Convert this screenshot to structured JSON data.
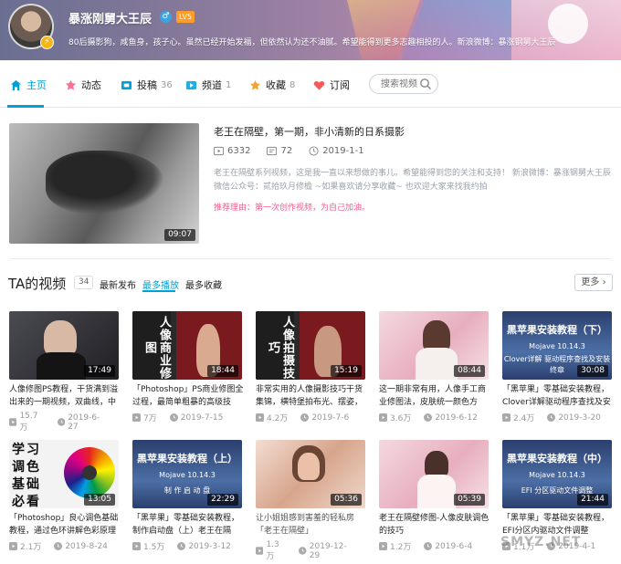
{
  "profile": {
    "name": "暴涨刚舅大王辰",
    "level": "LV5",
    "gender_symbol": "♂",
    "verified_symbol": "⚡",
    "signature": "80后摄影狗，咸鱼身，孩子心。虽然已经开始发福，但依然认为还不油腻。希望能得到更多志趣相投的人。新浪微博：暴涨钢舅大王辰"
  },
  "nav": {
    "items": [
      {
        "label": "主页",
        "count": "",
        "icon": "home-icon"
      },
      {
        "label": "动态",
        "count": "",
        "icon": "dynamic-icon"
      },
      {
        "label": "投稿",
        "count": "36",
        "icon": "upload-icon"
      },
      {
        "label": "频道",
        "count": "1",
        "icon": "channel-icon"
      },
      {
        "label": "收藏",
        "count": "8",
        "icon": "star-icon"
      },
      {
        "label": "订阅",
        "count": "",
        "icon": "heart-icon"
      }
    ],
    "search_placeholder": "搜索视频"
  },
  "featured": {
    "title": "老王在隔壁，第一期，非小清新的日系摄影",
    "views": "6332",
    "danmaku": "72",
    "date": "2019-1-1",
    "duration": "09:07",
    "desc_line1": "老王在隔壁系列视频，这是我一直以来想做的事儿。希望能得到您的关注和支持！ 新浪微博：暴涨钢舅大王辰",
    "desc_line2": "微信公众号：贰拾玖月修檐 ~如果喜欢请分享收藏~ 也欢迎大家来找我约拍",
    "recommend": "推荐理由：第一次创作视频，为自己加油。"
  },
  "videos_section": {
    "title": "TA的视频",
    "count": "34",
    "sort": [
      "最新发布",
      "最多播放",
      "最多收藏"
    ],
    "more": "更多"
  },
  "videos": [
    {
      "title": "人像修图PS教程，干货满到溢出来的一期视频，双曲线，中",
      "views": "15.7万",
      "date": "2019-6-27",
      "duration": "17:49"
    },
    {
      "title": "「Photoshop」PS商业修图全过程，最简单粗暴的高级技",
      "views": "7万",
      "date": "2019-7-15",
      "duration": "18:44",
      "overlay": "人像商业修图"
    },
    {
      "title": "非常实用的人像摄影技巧干货集锦，横特堡拍布光、摆姿，",
      "views": "4.2万",
      "date": "2019-7-6",
      "duration": "15:19",
      "overlay": "人像拍摄技巧"
    },
    {
      "title": "这一期非常有用，人像手工商业修图法，皮肤统一颜色方",
      "views": "3.6万",
      "date": "2019-6-12",
      "duration": "08:44"
    },
    {
      "title": "「黑苹果」零基础安装教程，Clover详解驱动程序查找及安",
      "views": "2.4万",
      "date": "2019-3-20",
      "duration": "30:08",
      "overlay": "黑苹果安装教程（下）",
      "sub1": "Mojave 10.14.3",
      "sub2": "Clover详解 驱动程序查找及安装",
      "sub3": "终章"
    },
    {
      "title": "「Photoshop」良心调色基础教程，通过色环讲解色彩原理",
      "views": "2.1万",
      "date": "2019-8-24",
      "duration": "13:05",
      "overlay": "学习调色基础必看"
    },
    {
      "title": "「黑苹果」零基础安装教程，制作启动盘（上）老王在隔",
      "views": "1.5万",
      "date": "2019-3-12",
      "duration": "22:29",
      "overlay": "黑苹果安装教程（上）",
      "sub1": "Mojave 10.14.3",
      "sub2": "制 作 启 动 盘"
    },
    {
      "title": "让小姐姐感到害羞的轻私房「老王在隔壁」",
      "views": "1.3万",
      "date": "2019-12-29",
      "duration": "05:36"
    },
    {
      "title": "老王在隔壁修图-人像皮肤调色的技巧",
      "views": "1.2万",
      "date": "2019-6-4",
      "duration": "05:39"
    },
    {
      "title": "「黑苹果」零基础安装教程，EFI分区内驱动文件调整",
      "views": "1.1万",
      "date": "2019-4-1",
      "duration": "21:44",
      "overlay": "黑苹果安装教程（中）",
      "sub1": "Mojave 10.14.3",
      "sub2": "EFI 分区驱动文件调整"
    }
  ],
  "watermark": "SMYZ.NET",
  "colors": {
    "accent": "#00a1d6",
    "pink": "#f25d8e",
    "level": "#ff9c2a"
  }
}
